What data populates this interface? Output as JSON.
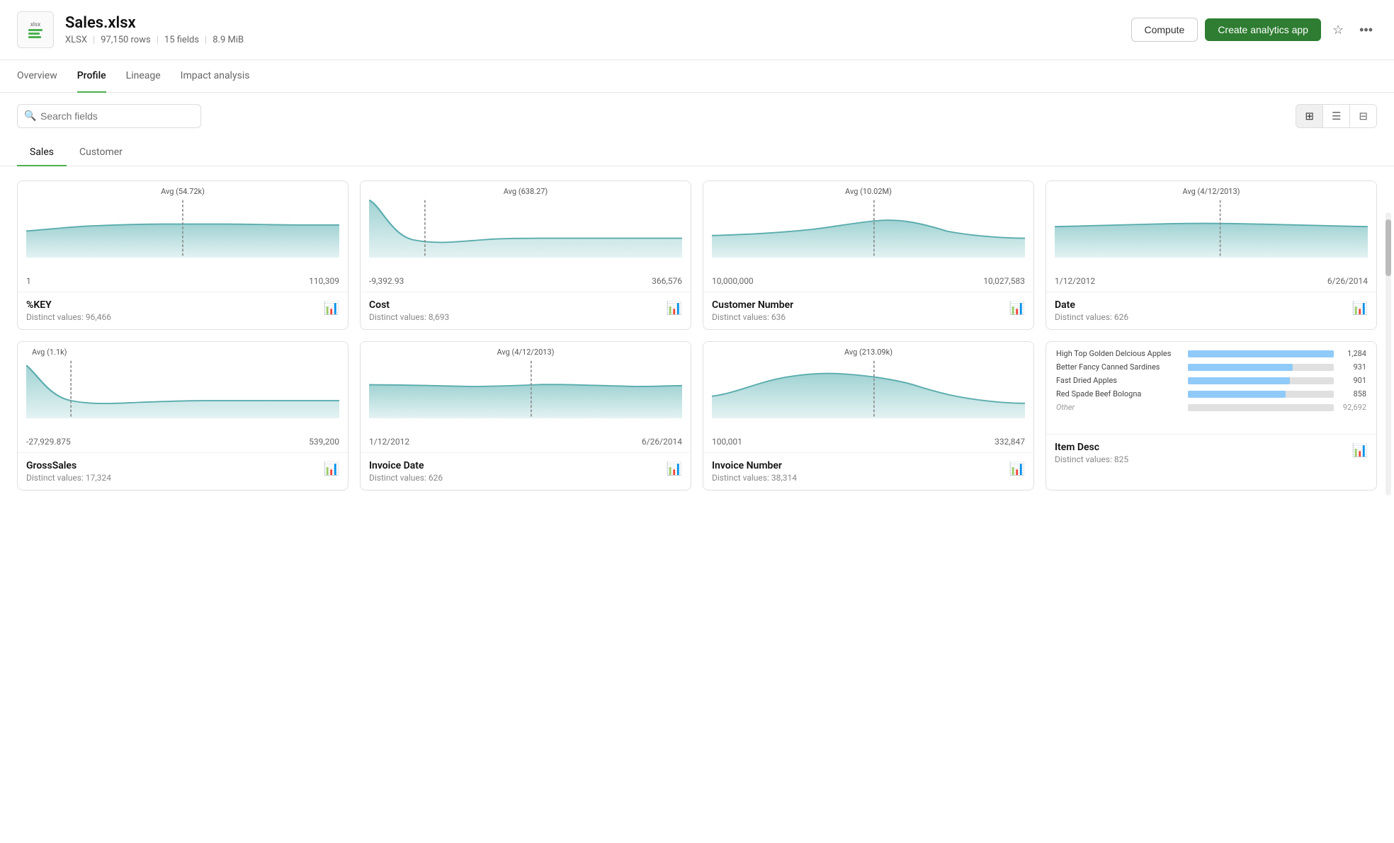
{
  "header": {
    "file_icon_ext": "xlsx",
    "title": "Sales.xlsx",
    "rows": "97,150 rows",
    "fields": "15 fields",
    "size": "8.9 MiB",
    "compute_label": "Compute",
    "create_label": "Create analytics app"
  },
  "tabs": [
    {
      "id": "overview",
      "label": "Overview",
      "active": false
    },
    {
      "id": "profile",
      "label": "Profile",
      "active": true
    },
    {
      "id": "lineage",
      "label": "Lineage",
      "active": false
    },
    {
      "id": "impact",
      "label": "Impact analysis",
      "active": false
    }
  ],
  "search": {
    "placeholder": "Search fields"
  },
  "sub_tabs": [
    {
      "id": "sales",
      "label": "Sales",
      "active": true
    },
    {
      "id": "customer",
      "label": "Customer",
      "active": false
    }
  ],
  "cards": [
    {
      "id": "pct_key",
      "name": "%KEY",
      "distinct": "Distinct values: 96,466",
      "avg_label": "Avg (54.72k)",
      "range_min": "1",
      "range_max": "110,309",
      "chart_type": "area",
      "chart_color": "#b2d8d8"
    },
    {
      "id": "cost",
      "name": "Cost",
      "distinct": "Distinct values: 8,693",
      "avg_label": "Avg (638.27)",
      "range_min": "-9,392.93",
      "range_max": "366,576",
      "chart_type": "area",
      "chart_color": "#b2d8d8"
    },
    {
      "id": "customer_number",
      "name": "Customer Number",
      "distinct": "Distinct values: 636",
      "avg_label": "Avg (10.02M)",
      "range_min": "10,000,000",
      "range_max": "10,027,583",
      "chart_type": "area",
      "chart_color": "#b2d8d8"
    },
    {
      "id": "date",
      "name": "Date",
      "distinct": "Distinct values: 626",
      "avg_label": "Avg (4/12/2013)",
      "range_min": "1/12/2012",
      "range_max": "6/26/2014",
      "chart_type": "area",
      "chart_color": "#b2d8d8"
    },
    {
      "id": "gross_sales",
      "name": "GrossSales",
      "distinct": "Distinct values: 17,324",
      "avg_label": "Avg (1.1k)",
      "range_min": "-27,929.875",
      "range_max": "539,200",
      "chart_type": "area",
      "chart_color": "#b2d8d8"
    },
    {
      "id": "invoice_date",
      "name": "Invoice Date",
      "distinct": "Distinct values: 626",
      "avg_label": "Avg (4/12/2013)",
      "range_min": "1/12/2012",
      "range_max": "6/26/2014",
      "chart_type": "area",
      "chart_color": "#b2d8d8"
    },
    {
      "id": "invoice_number",
      "name": "Invoice Number",
      "distinct": "Distinct values: 38,314",
      "avg_label": "Avg (213.09k)",
      "range_min": "100,001",
      "range_max": "332,847",
      "chart_type": "area",
      "chart_color": "#b2d8d8"
    },
    {
      "id": "item_desc",
      "name": "Item Desc",
      "distinct": "Distinct values: 825",
      "chart_type": "bar",
      "bar_items": [
        {
          "label": "High Top Golden Delcious Apples",
          "count": "1,284",
          "pct": 100
        },
        {
          "label": "Better Fancy Canned Sardines",
          "count": "931",
          "pct": 72
        },
        {
          "label": "Fast Dried Apples",
          "count": "901",
          "pct": 70
        },
        {
          "label": "Red Spade Beef Bologna",
          "count": "858",
          "pct": 67
        },
        {
          "label": "Other",
          "count": "92,692",
          "pct": 0,
          "is_other": true
        }
      ]
    }
  ]
}
